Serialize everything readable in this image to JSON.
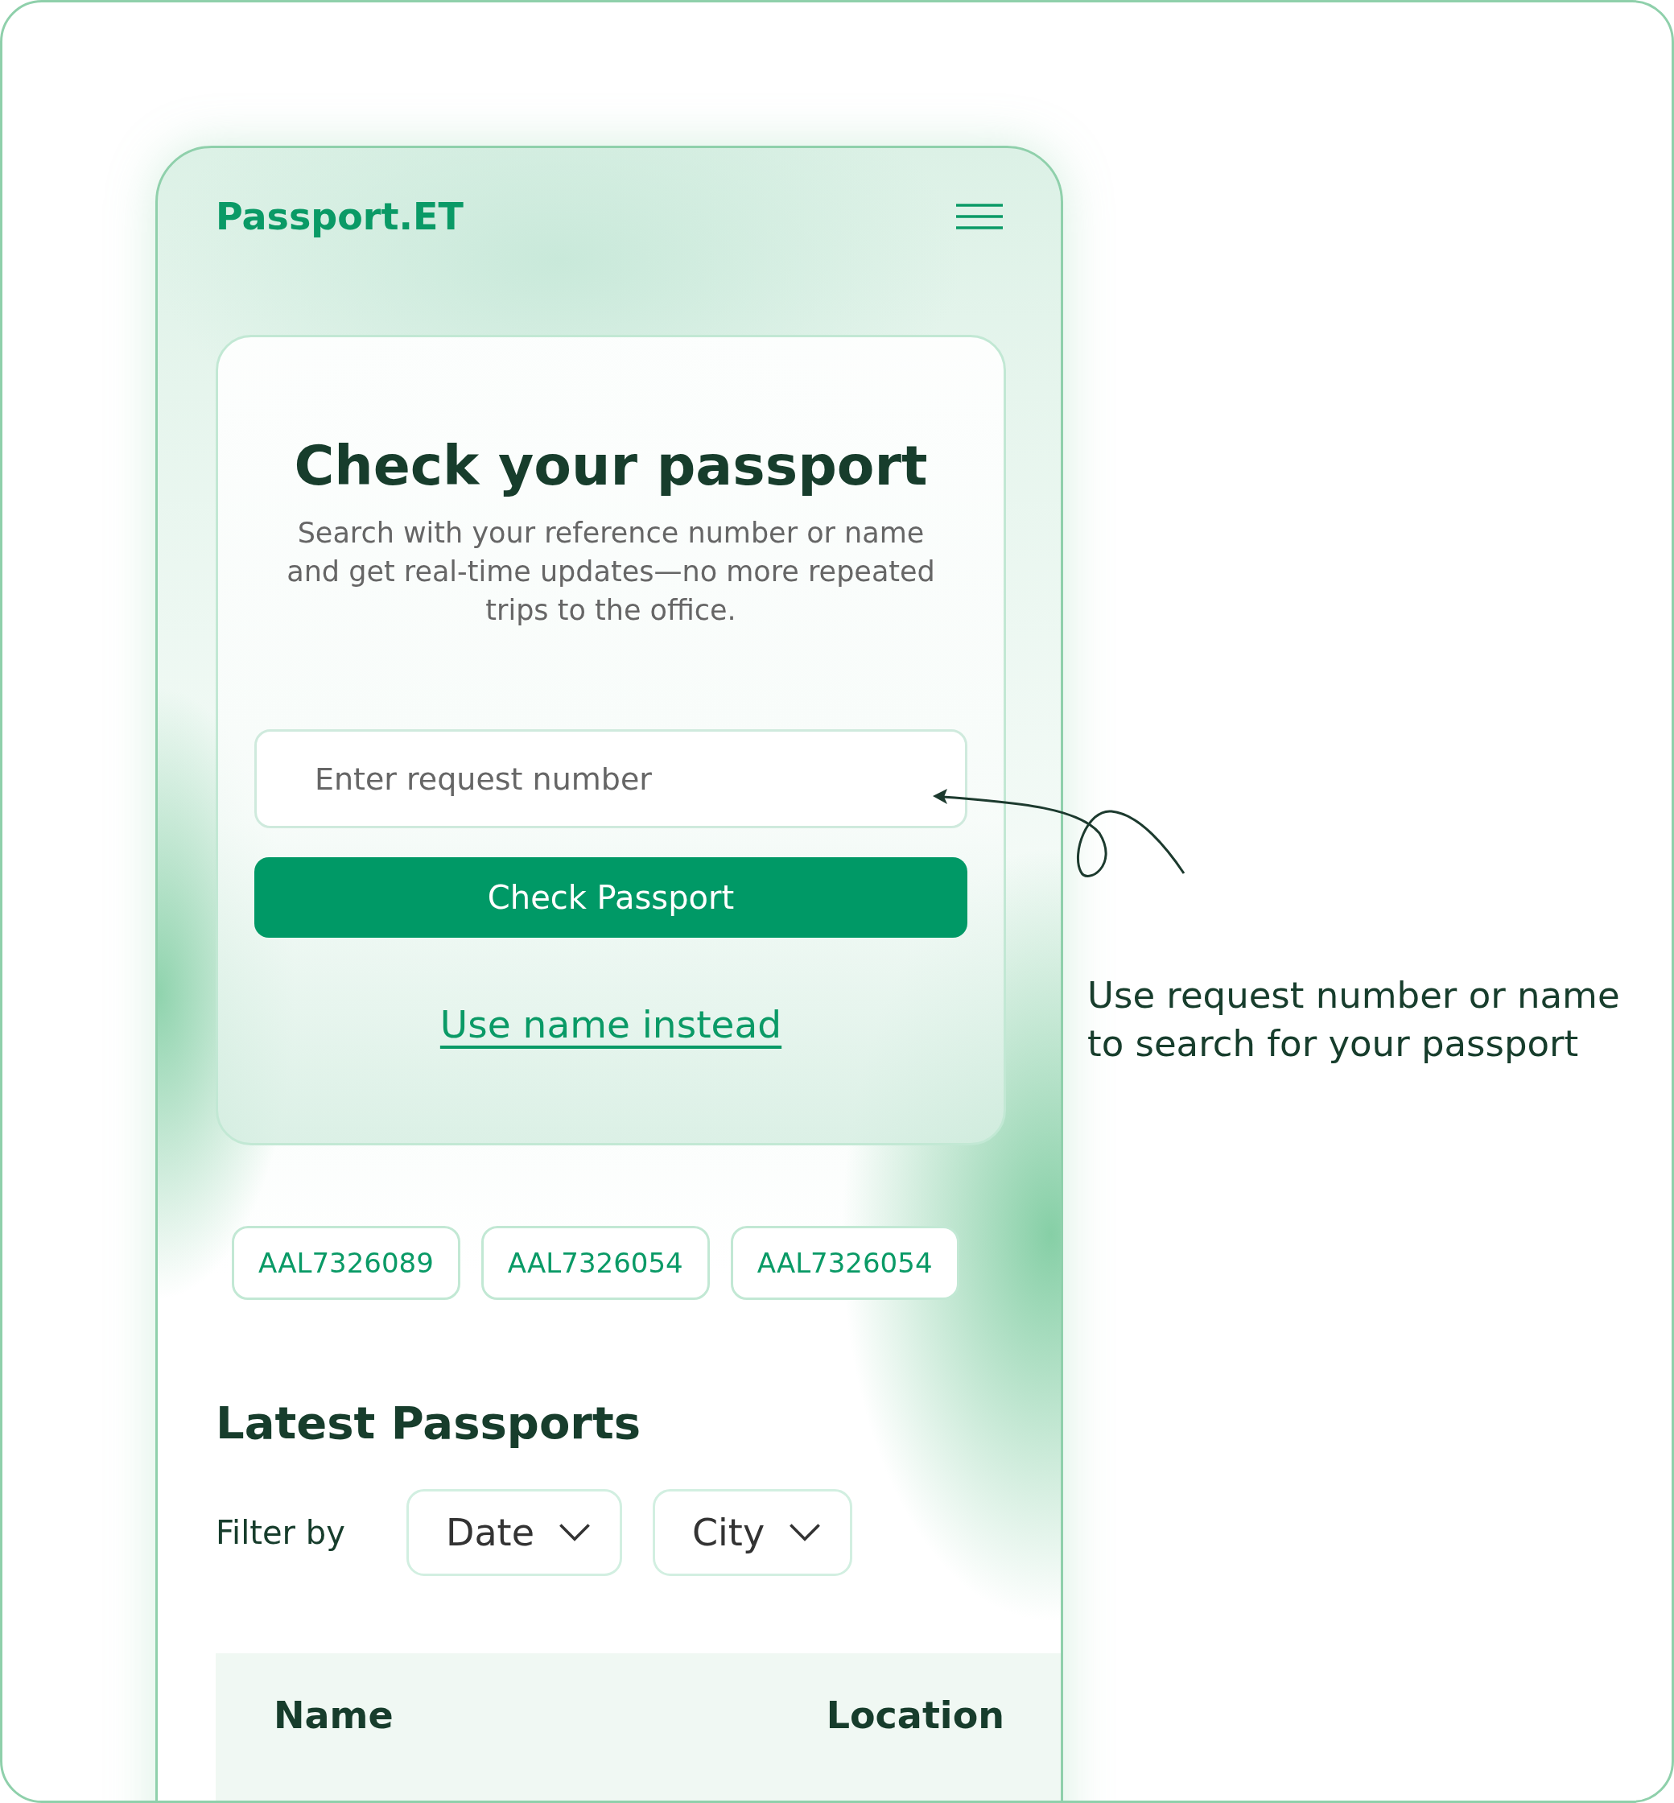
{
  "header": {
    "logo": "Passport.ET"
  },
  "search_card": {
    "title": "Check your passport",
    "description": "Search with your reference number or name and get real-time updates—no more repeated trips to the office.",
    "input": {
      "placeholder": "Enter request number"
    },
    "button": "Check Passport",
    "link": "Use name instead"
  },
  "recent_chips": [
    "AAL7326089",
    "AAL7326054",
    "AAL7326054"
  ],
  "latest": {
    "title": "Latest Passports",
    "filter_label": "Filter by",
    "filters": [
      "Date",
      "City"
    ],
    "columns": [
      "Name",
      "Location"
    ]
  },
  "annotation": "Use request number or name to search for your passport"
}
